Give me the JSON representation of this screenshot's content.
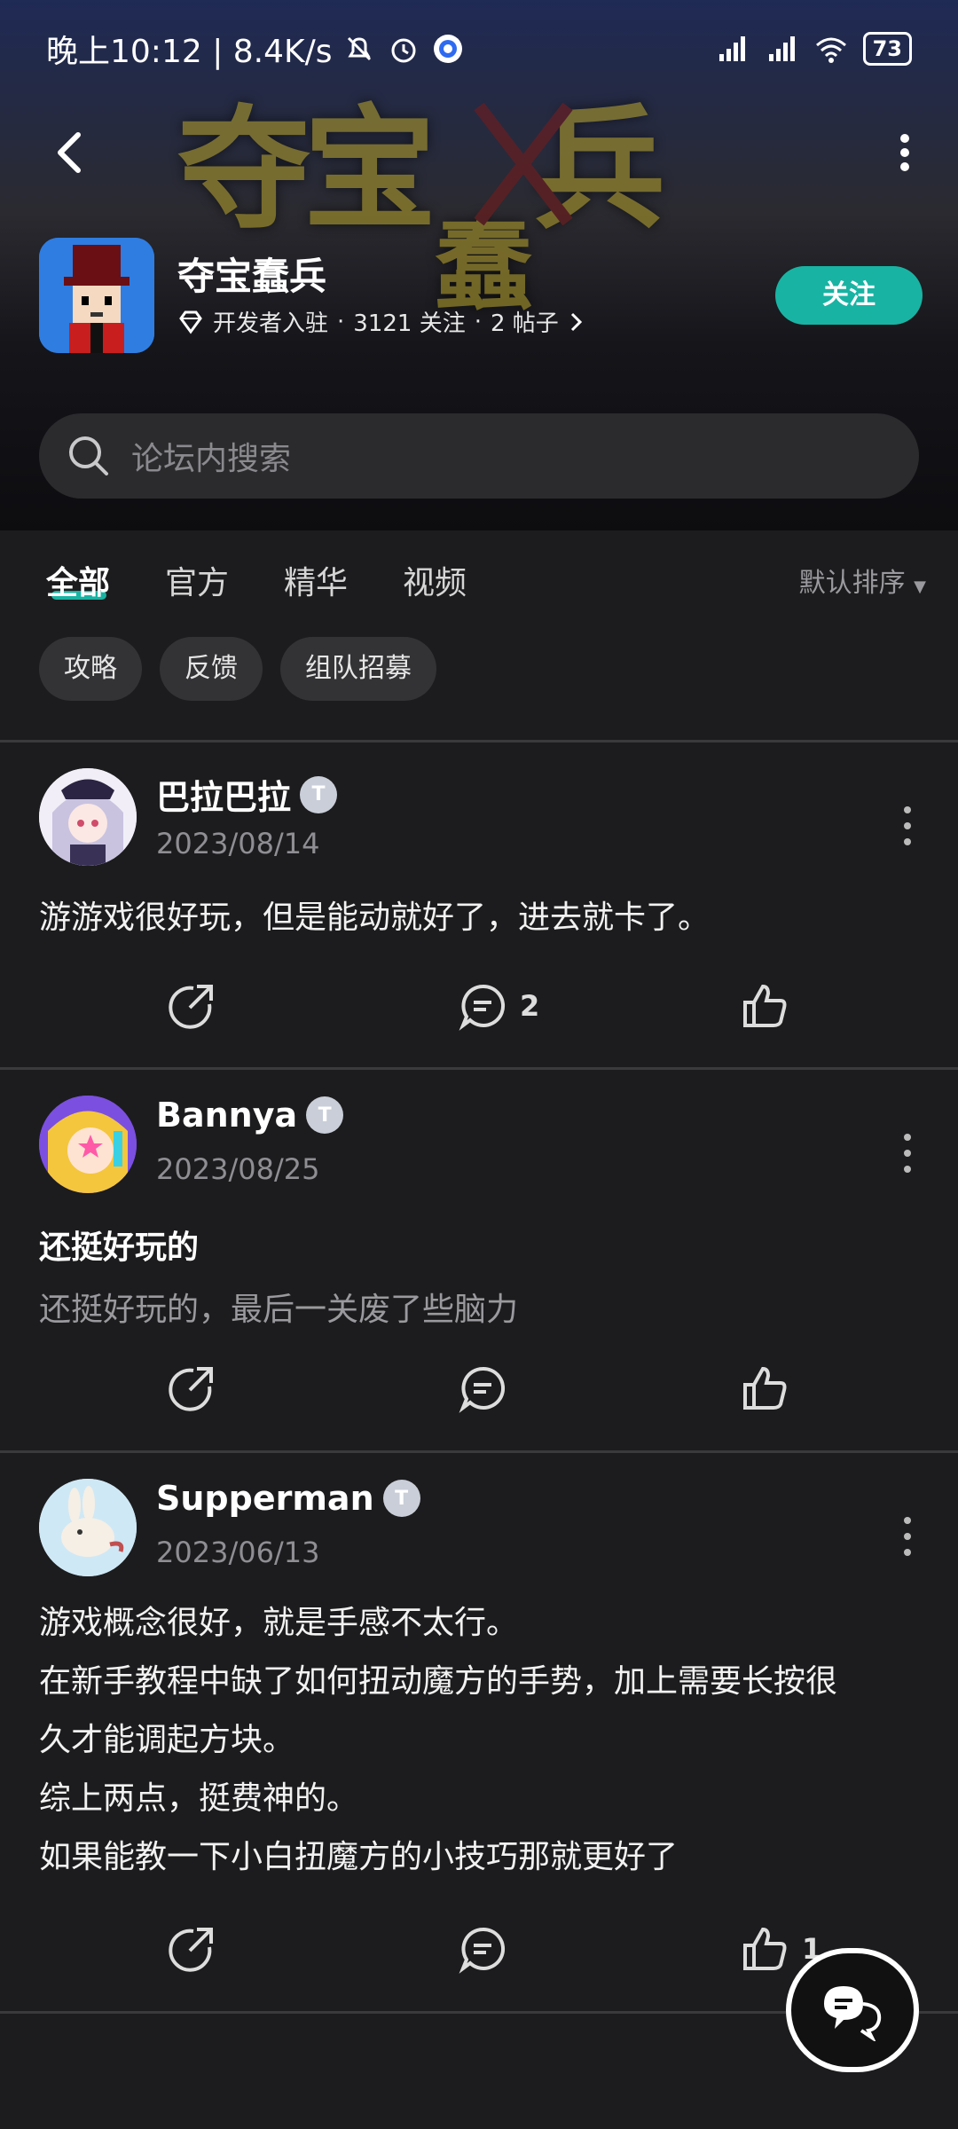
{
  "status": {
    "time_speed": "晚上10:12 | 8.4K/s",
    "battery": "73"
  },
  "banner": {
    "art_text_1": "夺宝",
    "art_text_2": "兵",
    "art_text_3": "蠢"
  },
  "app": {
    "name": "夺宝蠢兵",
    "dev_label": "开发者入驻",
    "follow_count": "3121 关注",
    "posts_count": "2 帖子",
    "follow_button": "关注"
  },
  "search": {
    "placeholder": "论坛内搜索"
  },
  "tabs": [
    {
      "label": "全部"
    },
    {
      "label": "官方"
    },
    {
      "label": "精华"
    },
    {
      "label": "视频"
    }
  ],
  "sort_label": "默认排序",
  "chips": [
    {
      "label": "攻略"
    },
    {
      "label": "反馈"
    },
    {
      "label": "组队招募"
    }
  ],
  "posts": [
    {
      "author": "巴拉巴拉",
      "date": "2023/08/14",
      "body": "游游戏很好玩，但是能动就好了，进去就卡了。",
      "comments": "2",
      "likes": ""
    },
    {
      "author": "Bannya",
      "date": "2023/08/25",
      "title": "还挺好玩的",
      "body": "还挺好玩的，最后一关废了些脑力",
      "comments": "",
      "likes": ""
    },
    {
      "author": "Supperman",
      "date": "2023/06/13",
      "lines": [
        "游戏概念很好，就是手感不太行。",
        "在新手教程中缺了如何扭动魔方的手势，加上需要长按很",
        "久才能调起方块。",
        "综上两点，挺费神的。",
        "如果能教一下小白扭魔方的小技巧那就更好了"
      ],
      "comments": "",
      "likes": "1"
    }
  ],
  "colors": {
    "accent": "#19b3a3",
    "background": "#1c1c1e"
  }
}
